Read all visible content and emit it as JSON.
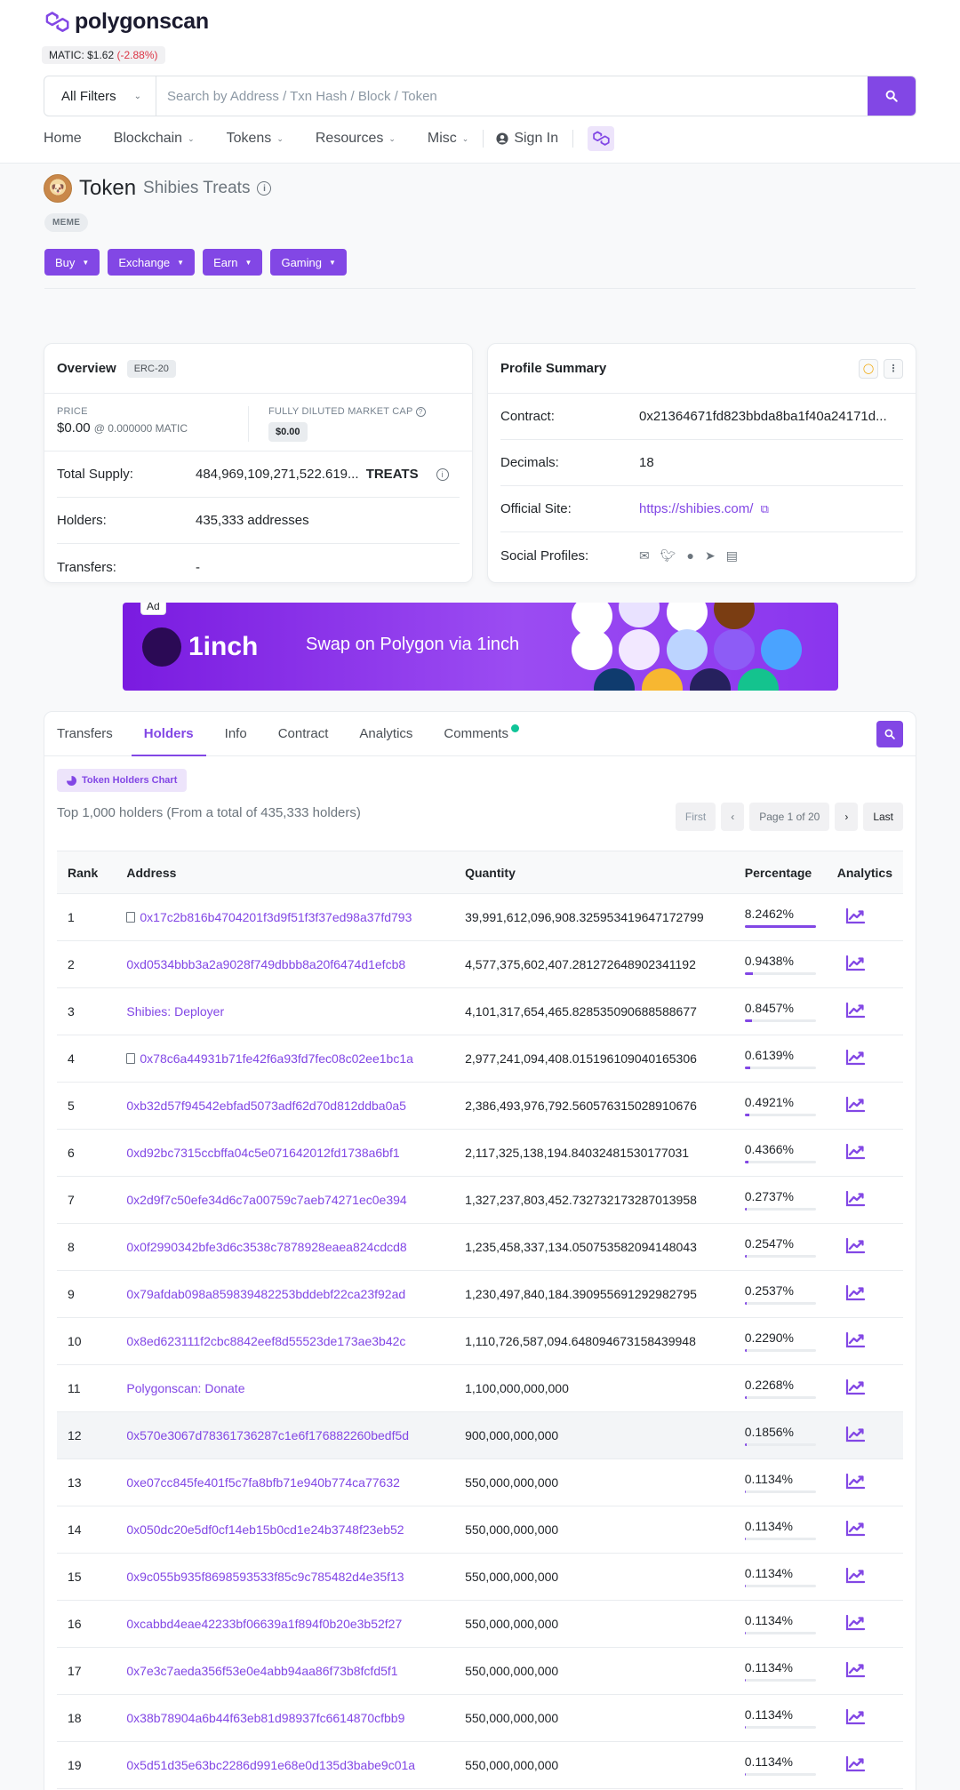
{
  "brand": {
    "name": "polygonscan",
    "accent": "#8247e5"
  },
  "price_ticker": {
    "label": "MATIC:",
    "value": "$1.62",
    "change": "(-2.88%)"
  },
  "search": {
    "filter": "All Filters",
    "placeholder": "Search by Address / Txn Hash / Block / Token"
  },
  "nav": {
    "home": "Home",
    "blockchain": "Blockchain",
    "tokens": "Tokens",
    "resources": "Resources",
    "misc": "Misc",
    "signin": "Sign In"
  },
  "token": {
    "label": "Token",
    "name": "Shibies Treats",
    "tag": "MEME"
  },
  "actions": {
    "buy": "Buy",
    "exchange": "Exchange",
    "earn": "Earn",
    "gaming": "Gaming"
  },
  "overview": {
    "title": "Overview",
    "standard": "ERC-20",
    "price_label": "PRICE",
    "price": "$0.00",
    "price_matic": "@ 0.000000 MATIC",
    "mcap_label": "FULLY DILUTED MARKET CAP",
    "mcap": "$0.00",
    "supply_label": "Total Supply:",
    "supply": "484,969,109,271,522.619...",
    "symbol": "TREATS",
    "holders_label": "Holders:",
    "holders": "435,333 addresses",
    "transfers_label": "Transfers:",
    "transfers": "-"
  },
  "profile": {
    "title": "Profile Summary",
    "contract_label": "Contract:",
    "contract": "0x21364671fd823bbda8ba1f40a24171d...",
    "decimals_label": "Decimals:",
    "decimals": "18",
    "site_label": "Official Site:",
    "site": "https://shibies.com/",
    "social_label": "Social Profiles:"
  },
  "ad": {
    "label": "Ad",
    "brand": "1inch",
    "text": "Swap on Polygon via 1inch"
  },
  "tabs": {
    "transfers": "Transfers",
    "holders": "Holders",
    "info": "Info",
    "contract": "Contract",
    "analytics": "Analytics",
    "comments": "Comments"
  },
  "holders_section": {
    "chart_button": "Token Holders Chart",
    "summary": "Top 1,000 holders (From a total of 435,333 holders)",
    "pager": {
      "first": "First",
      "prev": "‹",
      "page": "Page 1 of 20",
      "next": "›",
      "last": "Last"
    },
    "columns": {
      "rank": "Rank",
      "address": "Address",
      "quantity": "Quantity",
      "percentage": "Percentage",
      "analytics": "Analytics"
    }
  },
  "holders": [
    {
      "rank": "1",
      "address": "0x17c2b816b4704201f3d9f51f3f37ed98a37fd793",
      "contract": true,
      "quantity": "39,991,612,096,908.325953419647172799",
      "pct": "8.2462%",
      "fill": 100
    },
    {
      "rank": "2",
      "address": "0xd0534bbb3a2a9028f749dbbb8a20f6474d1efcb8",
      "contract": false,
      "quantity": "4,577,375,602,407.281272648902341192",
      "pct": "0.9438%",
      "fill": 11.4
    },
    {
      "rank": "3",
      "address": "Shibies: Deployer",
      "contract": false,
      "quantity": "4,101,317,654,465.828535090688588677",
      "pct": "0.8457%",
      "fill": 10.3
    },
    {
      "rank": "4",
      "address": "0x78c6a44931b71fe42f6a93fd7fec08c02ee1bc1a",
      "contract": true,
      "quantity": "2,977,241,094,408.015196109040165306",
      "pct": "0.6139%",
      "fill": 7.4
    },
    {
      "rank": "5",
      "address": "0xb32d57f94542ebfad5073adf62d70d812ddba0a5",
      "contract": false,
      "quantity": "2,386,493,976,792.560576315028910676",
      "pct": "0.4921%",
      "fill": 6.0
    },
    {
      "rank": "6",
      "address": "0xd92bc7315ccbffa04c5e071642012fd1738a6bf1",
      "contract": false,
      "quantity": "2,117,325,138,194.84032481530177031",
      "pct": "0.4366%",
      "fill": 5.3
    },
    {
      "rank": "7",
      "address": "0x2d9f7c50efe34d6c7a00759c7aeb74271ec0e394",
      "contract": false,
      "quantity": "1,327,237,803,452.732732173287013958",
      "pct": "0.2737%",
      "fill": 3.3
    },
    {
      "rank": "8",
      "address": "0x0f2990342bfe3d6c3538c7878928eaea824cdcd8",
      "contract": false,
      "quantity": "1,235,458,337,134.050753582094148043",
      "pct": "0.2547%",
      "fill": 3.1
    },
    {
      "rank": "9",
      "address": "0x79afdab098a859839482253bddebf22ca23f92ad",
      "contract": false,
      "quantity": "1,230,497,840,184.390955691292982795",
      "pct": "0.2537%",
      "fill": 3.1
    },
    {
      "rank": "10",
      "address": "0x8ed623111f2cbc8842eef8d55523de173ae3b42c",
      "contract": false,
      "quantity": "1,110,726,587,094.648094673158439948",
      "pct": "0.2290%",
      "fill": 2.8
    },
    {
      "rank": "11",
      "address": "Polygonscan: Donate",
      "contract": false,
      "quantity": "1,100,000,000,000",
      "pct": "0.2268%",
      "fill": 2.8
    },
    {
      "rank": "12",
      "address": "0x570e3067d78361736287c1e6f176882260bedf5d",
      "contract": false,
      "quantity": "900,000,000,000",
      "pct": "0.1856%",
      "fill": 2.3,
      "highlight": true
    },
    {
      "rank": "13",
      "address": "0xe07cc845fe401f5c7fa8bfb71e940b774ca77632",
      "contract": false,
      "quantity": "550,000,000,000",
      "pct": "0.1134%",
      "fill": 1.4
    },
    {
      "rank": "14",
      "address": "0x050dc20e5df0cf14eb15b0cd1e24b3748f23eb52",
      "contract": false,
      "quantity": "550,000,000,000",
      "pct": "0.1134%",
      "fill": 1.4
    },
    {
      "rank": "15",
      "address": "0x9c055b935f8698593533f85c9c785482d4e35f13",
      "contract": false,
      "quantity": "550,000,000,000",
      "pct": "0.1134%",
      "fill": 1.4
    },
    {
      "rank": "16",
      "address": "0xcabbd4eae42233bf06639a1f894f0b20e3b52f27",
      "contract": false,
      "quantity": "550,000,000,000",
      "pct": "0.1134%",
      "fill": 1.4
    },
    {
      "rank": "17",
      "address": "0x7e3c7aeda356f53e0e4abb94aa86f73b8fcfd5f1",
      "contract": false,
      "quantity": "550,000,000,000",
      "pct": "0.1134%",
      "fill": 1.4
    },
    {
      "rank": "18",
      "address": "0x38b78904a6b44f63eb81d98937fc6614870cfbb9",
      "contract": false,
      "quantity": "550,000,000,000",
      "pct": "0.1134%",
      "fill": 1.4
    },
    {
      "rank": "19",
      "address": "0x5d51d35e63bc2286d991e68e0d135d3babe9c01a",
      "contract": false,
      "quantity": "550,000,000,000",
      "pct": "0.1134%",
      "fill": 1.4
    }
  ]
}
